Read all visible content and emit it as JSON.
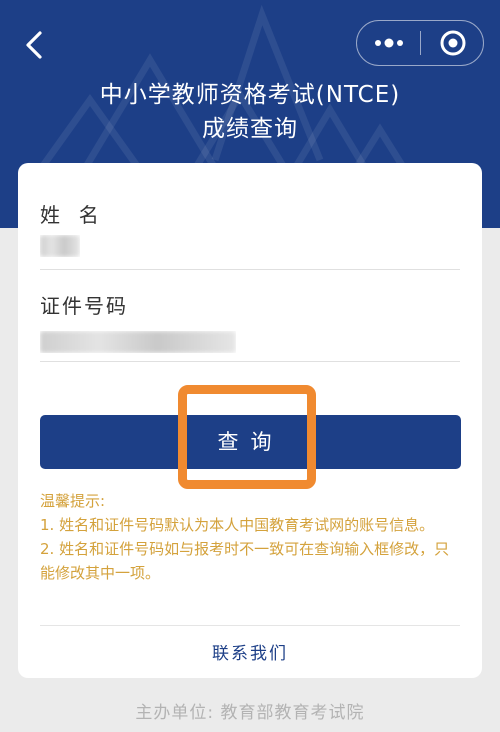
{
  "header": {
    "title_line1": "中小学教师资格考试(NTCE)",
    "title_line2": "成绩查询",
    "background_color": "#1d3f87",
    "back_icon": "chevron-left-icon",
    "more_icon": "more-dots-icon",
    "close_icon": "target-circle-icon"
  },
  "form": {
    "name_label": "姓  名",
    "id_label": "证件号码"
  },
  "query_button": {
    "label": "查询"
  },
  "tips": {
    "heading": "温馨提示:",
    "items": [
      "1. 姓名和证件号码默认为本人中国教育考试网的账号信息。",
      "2. 姓名和证件号码如与报考时不一致可在查询输入框修改，只能修改其中一项。"
    ],
    "color": "#d4a23c"
  },
  "contact": {
    "label": "联系我们"
  },
  "footer": {
    "text": "主办单位: 教育部教育考试院"
  },
  "highlight_color": "#f08a30"
}
